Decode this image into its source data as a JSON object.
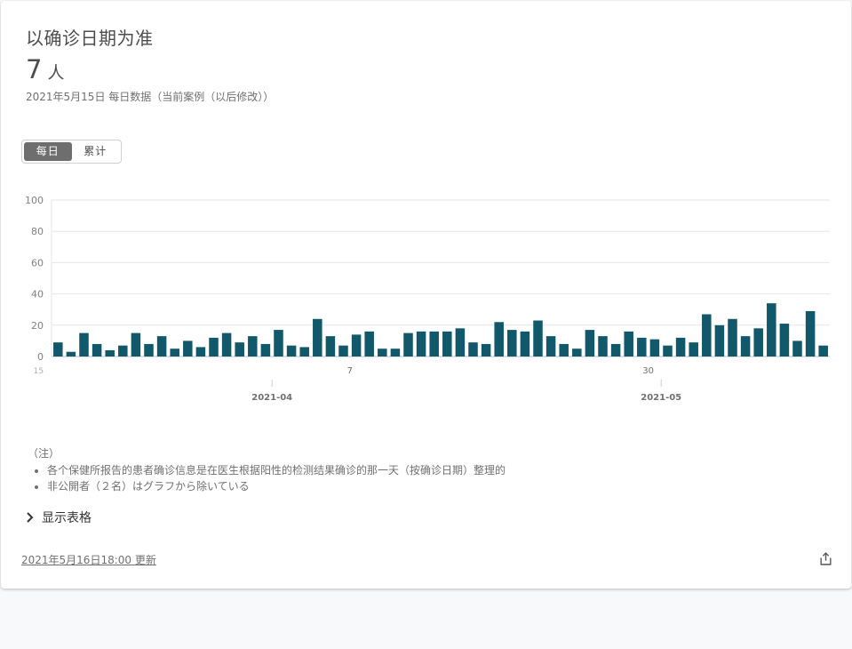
{
  "card": {
    "title": "以确诊日期为准",
    "value": "7",
    "unit": "人",
    "subtitle": "2021年5月15日 每日数据（当前案例（以后修改））"
  },
  "toggle": {
    "daily_label": "每日",
    "cumulative_label": "累计",
    "selected": "daily"
  },
  "chart_data": {
    "type": "bar",
    "title": "",
    "xlabel": "",
    "ylabel": "",
    "ylim": [
      0,
      100
    ],
    "yticks": [
      0,
      20,
      40,
      60,
      80,
      100
    ],
    "grid": true,
    "bar_color": "#11596a",
    "x_start": "2021-03-15",
    "x_tick_labels": [
      "15",
      "7",
      "30"
    ],
    "month_labels": [
      "2021-04",
      "2021-05"
    ],
    "values": [
      9,
      3,
      15,
      8,
      4,
      7,
      15,
      8,
      13,
      5,
      10,
      6,
      12,
      15,
      9,
      13,
      8,
      17,
      7,
      6,
      24,
      13,
      7,
      14,
      16,
      5,
      5,
      15,
      16,
      16,
      16,
      18,
      9,
      8,
      22,
      17,
      16,
      23,
      13,
      8,
      5,
      17,
      13,
      8,
      16,
      12,
      11,
      7,
      12,
      9,
      27,
      20,
      24,
      13,
      18,
      34,
      21,
      10,
      29,
      7
    ]
  },
  "notes": {
    "heading": "（注）",
    "items": [
      "各个保健所报告的患者确诊信息是在医生根据阳性的检测结果确诊的那一天（按确诊日期）整理的",
      "非公開者（２名）はグラフから除いている"
    ]
  },
  "table_toggle": {
    "label": "显示表格",
    "icon": "chevron-right-icon"
  },
  "footer": {
    "updated": "2021年5月16日18:00 更新",
    "share_icon": "share-icon"
  }
}
